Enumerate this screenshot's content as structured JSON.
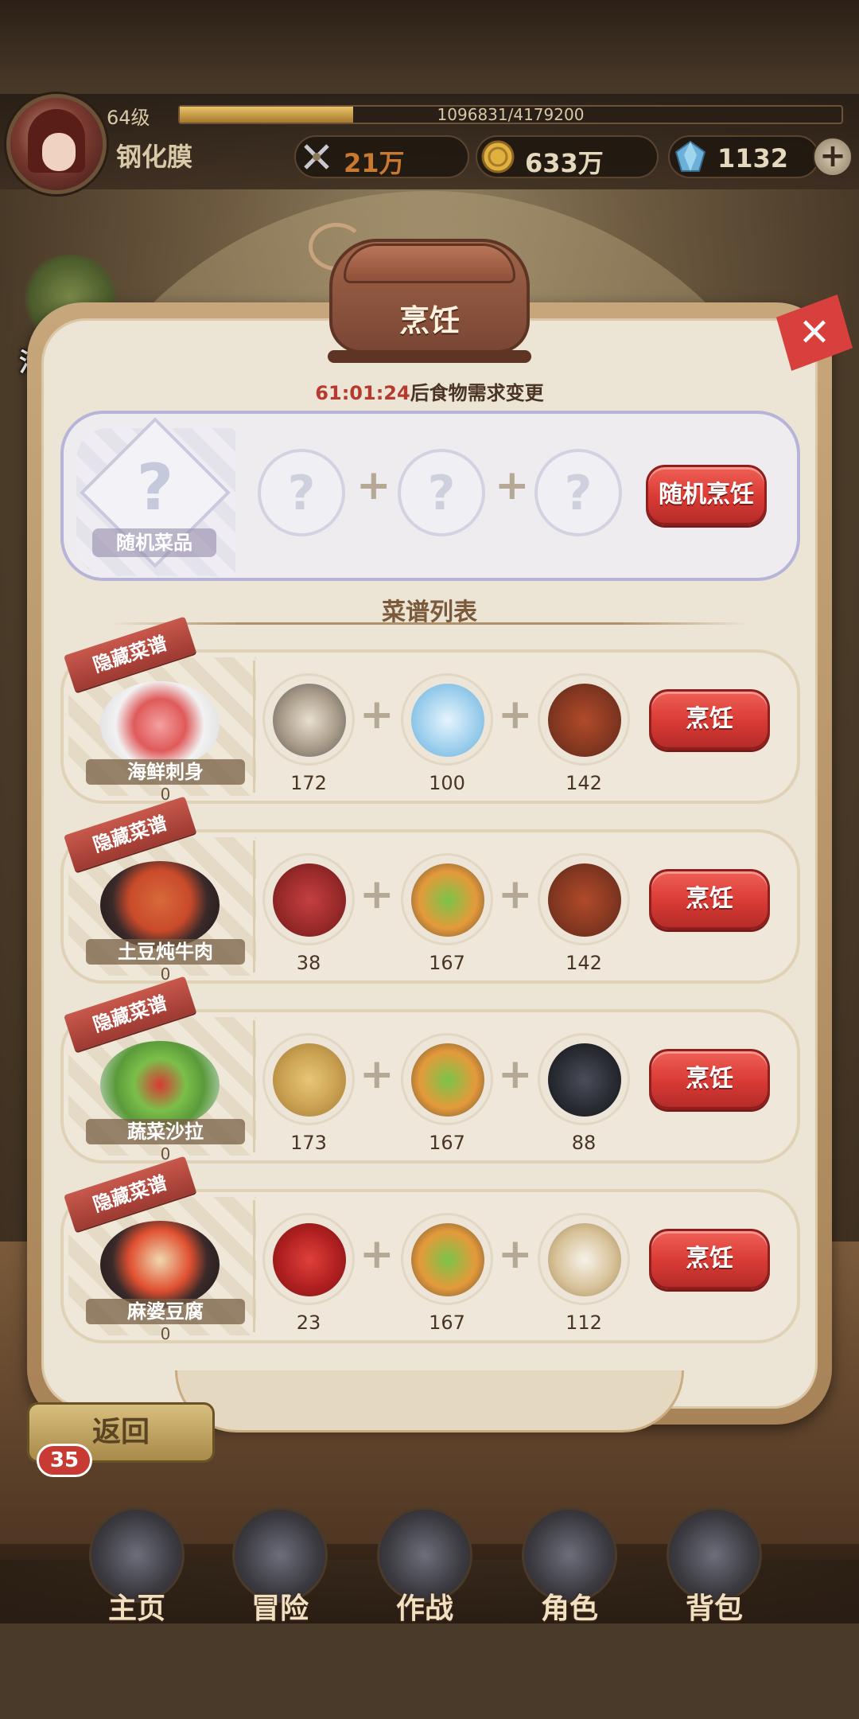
{
  "player": {
    "level": "64级",
    "xp_text": "1096831/4179200",
    "xp_fraction": 0.262,
    "name": "钢化膜",
    "power": "21万",
    "gold": "633万",
    "gems": "1132"
  },
  "event_label": "活动",
  "panel": {
    "title": "烹饪",
    "countdown_time": "61:01:24",
    "countdown_suffix": "后食物需求变更",
    "random": {
      "dish_label": "随机菜品",
      "slot_symbol": "?",
      "button_label": "随机烹饪"
    },
    "section_title": "菜谱列表",
    "recipes": [
      {
        "tag": "隐藏菜谱",
        "name": "海鲜刺身",
        "count": "0",
        "ingredients": [
          {
            "icon": "seafood-icon",
            "count": "172"
          },
          {
            "icon": "ice-cube-icon",
            "count": "100"
          },
          {
            "icon": "spice-icon",
            "count": "142"
          }
        ],
        "button_label": "烹饪"
      },
      {
        "tag": "隐藏菜谱",
        "name": "土豆炖牛肉",
        "count": "0",
        "ingredients": [
          {
            "icon": "beef-icon",
            "count": "38"
          },
          {
            "icon": "vegetables-icon",
            "count": "167"
          },
          {
            "icon": "spice-icon",
            "count": "142"
          }
        ],
        "button_label": "烹饪"
      },
      {
        "tag": "隐藏菜谱",
        "name": "蔬菜沙拉",
        "count": "0",
        "ingredients": [
          {
            "icon": "potato-icon",
            "count": "173"
          },
          {
            "icon": "vegetables-icon",
            "count": "167"
          },
          {
            "icon": "black-fungus-icon",
            "count": "88"
          }
        ],
        "button_label": "烹饪"
      },
      {
        "tag": "隐藏菜谱",
        "name": "麻婆豆腐",
        "count": "0",
        "ingredients": [
          {
            "icon": "chili-pepper-icon",
            "count": "23"
          },
          {
            "icon": "vegetables-icon",
            "count": "167"
          },
          {
            "icon": "flour-icon",
            "count": "112"
          }
        ],
        "button_label": "烹饪"
      }
    ]
  },
  "bottom": {
    "return_label": "返回",
    "chat_badge": "35",
    "nav": [
      {
        "label": "主页",
        "icon": "castle-icon"
      },
      {
        "label": "冒险",
        "icon": "portal-icon"
      },
      {
        "label": "作战",
        "icon": "battle-icon"
      },
      {
        "label": "角色",
        "icon": "character-book-icon"
      },
      {
        "label": "背包",
        "icon": "backpack-icon"
      }
    ]
  },
  "colors": {
    "accent_red": "#d83a34",
    "countdown_red": "#b63a2e",
    "panel_bg": "#ece4d4"
  }
}
